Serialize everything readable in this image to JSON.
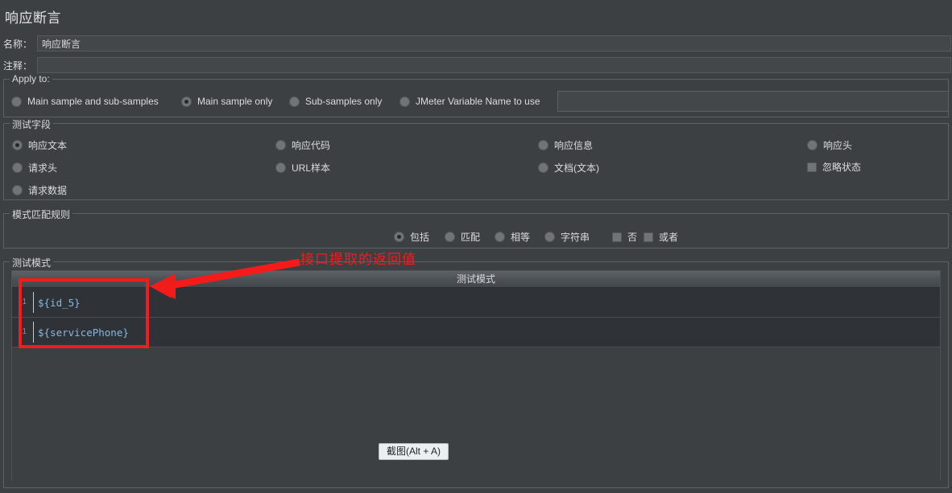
{
  "window": {
    "title": "响应断言"
  },
  "fields": {
    "name_label": "名称：",
    "name_value": "响应断言",
    "comment_label": "注释：",
    "comment_value": ""
  },
  "apply_to": {
    "group_title": "Apply to:",
    "options": [
      {
        "label": "Main sample and sub-samples",
        "selected": false
      },
      {
        "label": "Main sample only",
        "selected": true
      },
      {
        "label": "Sub-samples only",
        "selected": false
      },
      {
        "label": "JMeter Variable Name to use",
        "selected": false
      }
    ],
    "variable_value": "",
    "variable_placeholder": ""
  },
  "test_field": {
    "group_title": "测试字段",
    "column1": [
      {
        "label": "响应文本",
        "selected": true
      },
      {
        "label": "请求头",
        "selected": false
      },
      {
        "label": "请求数据",
        "selected": false
      }
    ],
    "column2": [
      {
        "label": "响应代码",
        "selected": false
      },
      {
        "label": "URL样本",
        "selected": false
      }
    ],
    "column3": [
      {
        "label": "响应信息",
        "selected": false
      },
      {
        "label": "文档(文本)",
        "selected": false
      }
    ],
    "column4": [
      {
        "label": "响应头",
        "type": "radio",
        "selected": false
      },
      {
        "label": "忽略状态",
        "type": "checkbox",
        "selected": false
      }
    ]
  },
  "pattern_rules": {
    "group_title": "模式匹配规则",
    "radios": [
      {
        "label": "包括",
        "selected": true
      },
      {
        "label": "匹配",
        "selected": false
      },
      {
        "label": "相等",
        "selected": false
      },
      {
        "label": "字符串",
        "selected": false
      }
    ],
    "checkboxes": [
      {
        "label": "否",
        "checked": false
      },
      {
        "label": "或者",
        "checked": false
      }
    ]
  },
  "test_pattern": {
    "group_title": "测试模式",
    "table_header": "测试模式",
    "rows": [
      {
        "num": "1",
        "value": "${id_5}"
      },
      {
        "num": "1",
        "value": "${servicePhone}"
      }
    ]
  },
  "annotation": {
    "text": "接口提取的返回值",
    "color": "#f41b1b"
  },
  "screenshot_button": {
    "label": "截图(Alt + A)"
  }
}
